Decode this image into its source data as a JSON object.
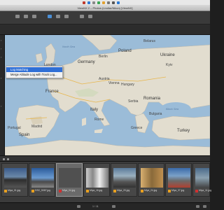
{
  "window": {
    "title": "ViewNX 2  –  Photos (Lindlar/Nikon) [ViewNX]"
  },
  "toolbar": {
    "items": [
      "Browser",
      "Viewer",
      "Full Screen",
      "Map",
      "Edit",
      "Compare",
      "Share",
      "Upload",
      "Print",
      "Movie"
    ]
  },
  "subbar": {
    "label": "Map"
  },
  "context_menu": {
    "items": [
      {
        "label": "Log Matching",
        "selected": true
      },
      {
        "label": "Merge Altitude Log with Track Log...",
        "selected": false
      }
    ]
  },
  "map": {
    "places": {
      "poland": "Poland",
      "germany": "Germany",
      "ukraine": "Ukraine",
      "france": "France",
      "italy": "Italy",
      "spain": "Spain",
      "romania": "Romania",
      "turkey": "Turkey",
      "belarus": "Belarus",
      "austria": "Austria",
      "hungary": "Hungary",
      "serbia": "Serbia",
      "bulgaria": "Bulgaria",
      "greece": "Greece",
      "portugal": "Portugal",
      "london": "London",
      "paris": "Paris",
      "berlin": "Berlin",
      "vienna": "Vienna",
      "rome": "Rome",
      "madrid": "Madrid",
      "kyiv": "Kyiv",
      "black_sea": "Black Sea",
      "north_sea": "North Sea"
    }
  },
  "filmstrip": {
    "thumbs": [
      {
        "name": "Miya_01.jpg",
        "flag": "orange"
      },
      {
        "name": "DSC_5087.jpg",
        "flag": "orange"
      },
      {
        "name": "Miya_04.jpg",
        "flag": "red"
      },
      {
        "name": "Miya_18.jpg",
        "flag": "orange"
      },
      {
        "name": "Miya_20.jpg",
        "flag": "orange"
      },
      {
        "name": "Miya_24.jpg",
        "flag": "orange"
      },
      {
        "name": "Miya_37.jpg",
        "flag": "orange"
      },
      {
        "name": "Miya_11.jpg",
        "flag": "red"
      }
    ]
  },
  "bottombar": {
    "pager": "1 / 11"
  },
  "colors": {
    "accent": "#2f6fd6",
    "sea": "#9bbcd8",
    "land": "#dedad0",
    "flag_orange": "#e8a020",
    "flag_red": "#d03030"
  }
}
